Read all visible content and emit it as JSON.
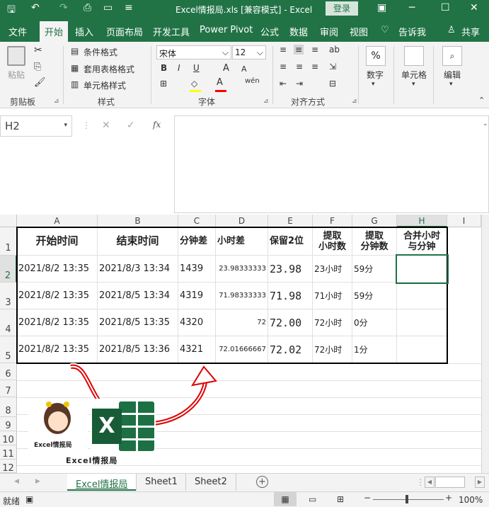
{
  "titlebar": {
    "title": "Excel情报局.xls  [兼容模式]  -  Excel",
    "login": "登录"
  },
  "ribbon_tabs": [
    "文件",
    "开始",
    "插入",
    "页面布局",
    "开发工具",
    "Power Pivot",
    "公式",
    "数据",
    "审阅",
    "视图",
    "告诉我",
    "共享"
  ],
  "ribbon": {
    "clipboard": {
      "paste": "粘贴",
      "group": "剪贴板"
    },
    "styles": {
      "cond": "条件格式",
      "table": "套用表格格式",
      "cell": "单元格样式",
      "group": "样式"
    },
    "font": {
      "name": "宋体",
      "size": "12",
      "group": "字体",
      "bold": "B",
      "italic": "I",
      "underline": "U",
      "wen": "wén"
    },
    "align": {
      "group": "对齐方式"
    },
    "number": {
      "label": "数字",
      "symbol": "%"
    },
    "cells": {
      "label": "单元格"
    },
    "edit": {
      "label": "编辑"
    }
  },
  "namebox": "H2",
  "fx": "fx",
  "columns": [
    "A",
    "B",
    "C",
    "D",
    "E",
    "F",
    "G",
    "H",
    "I"
  ],
  "rows": [
    "1",
    "2",
    "3",
    "4",
    "5",
    "6",
    "7",
    "8",
    "9",
    "10",
    "11",
    "12"
  ],
  "headers": {
    "a": "开始时间",
    "b": "结束时间",
    "c": "分钟差",
    "d": "小时差",
    "e": "保留2位",
    "f1": "提取",
    "f2": "小时数",
    "g1": "提取",
    "g2": "分钟数",
    "h1": "合并小时",
    "h2": "与分钟"
  },
  "data_rows": [
    {
      "a": "2021/8/2 13:35",
      "b": "2021/8/3 13:34",
      "c": "1439",
      "d": "23.98333333",
      "e": "23.98",
      "f": "23小时",
      "g": "59分"
    },
    {
      "a": "2021/8/2 13:35",
      "b": "2021/8/5 13:34",
      "c": "4319",
      "d": "71.98333333",
      "e": "71.98",
      "f": "71小时",
      "g": "59分"
    },
    {
      "a": "2021/8/2 13:35",
      "b": "2021/8/5 13:35",
      "c": "4320",
      "d": "72",
      "e": "72.00",
      "f": "72小时",
      "g": "0分"
    },
    {
      "a": "2021/8/2 13:35",
      "b": "2021/8/5 13:36",
      "c": "4321",
      "d": "72.01666667",
      "e": "72.02",
      "f": "72小时",
      "g": "1分"
    }
  ],
  "logo": {
    "small": "Excel情报局",
    "caption": "Excel情报局"
  },
  "sheet_tabs": [
    "Excel情报局",
    "Sheet1",
    "Sheet2"
  ],
  "status": {
    "ready": "就绪",
    "zoom": "100%"
  }
}
